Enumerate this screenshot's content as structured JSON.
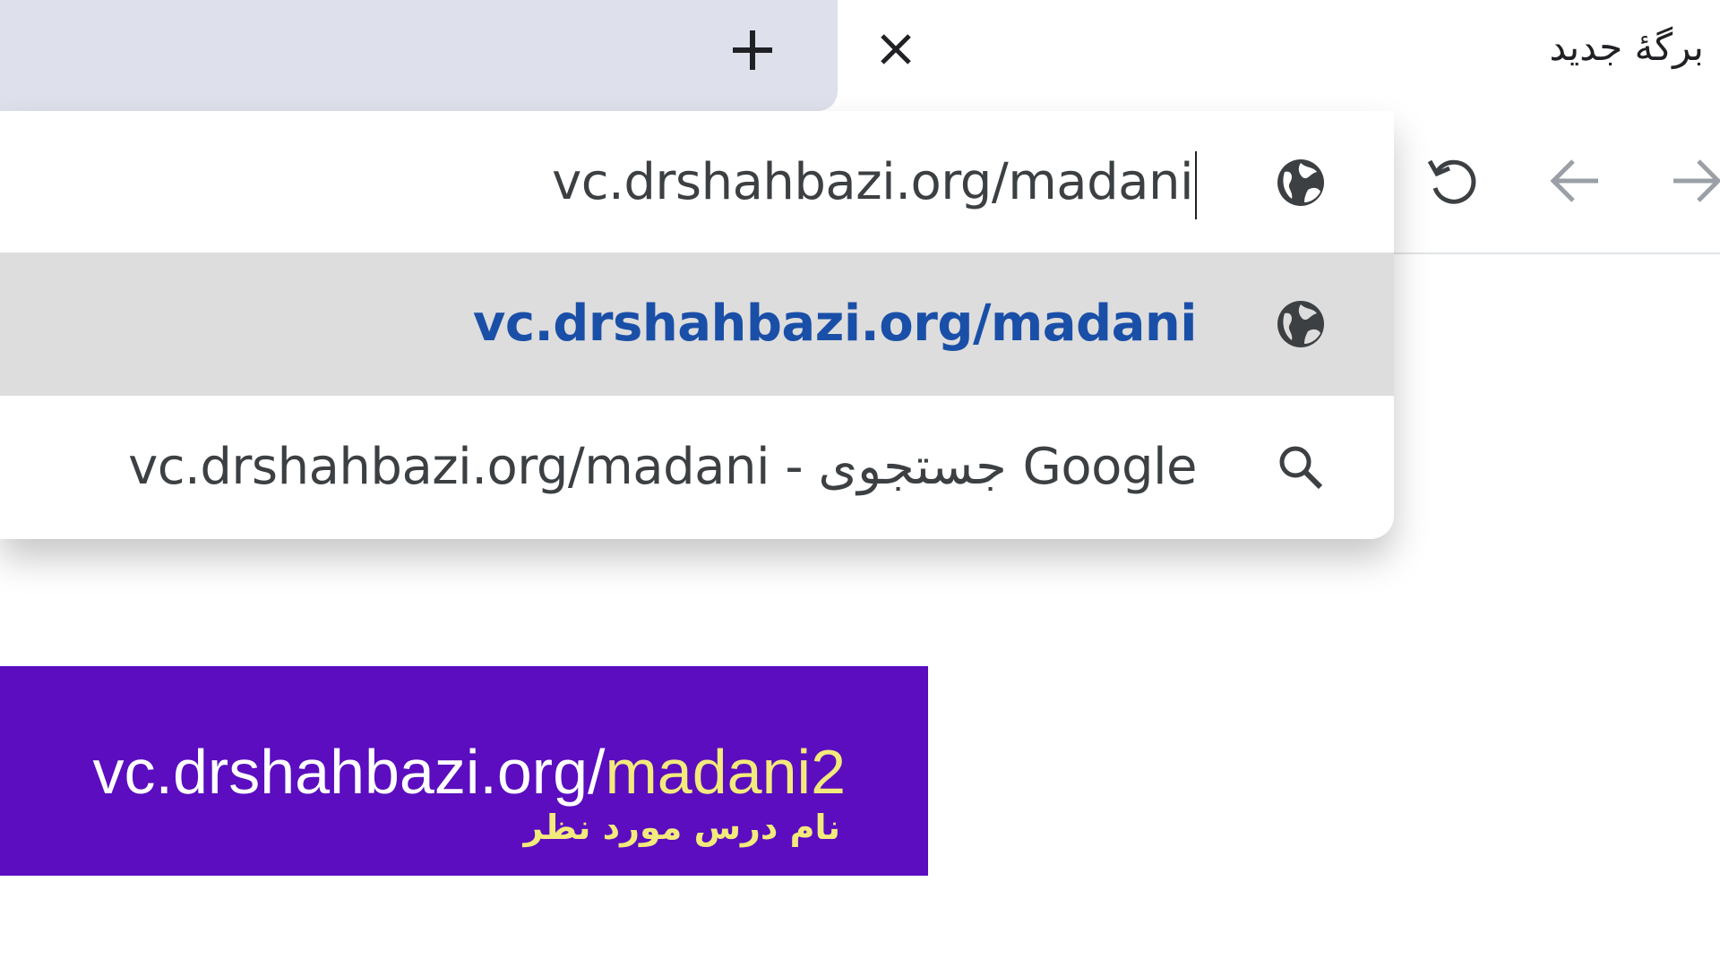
{
  "tabs": {
    "active_title": "برگهٔ جدید",
    "new_tab_icon": "plus-icon",
    "close_icon": "close-icon"
  },
  "toolbar": {
    "reload_icon": "reload-icon",
    "back_icon": "arrow-back-icon",
    "forward_icon": "arrow-forward-icon"
  },
  "omnibox": {
    "input_value": "vc.drshahbazi.org/madani",
    "input_icon": "globe-icon",
    "suggestions": [
      {
        "text": "vc.drshahbazi.org/madani",
        "icon": "globe-icon",
        "highlighted": true
      },
      {
        "text": "vc.drshahbazi.org/madani - جستجوی Google",
        "icon": "search-icon",
        "highlighted": false
      }
    ]
  },
  "banner": {
    "url_prefix": "vc.drshahbazi.org/",
    "url_suffix": "madani2",
    "caption": "نام درس مورد نظر"
  },
  "colors": {
    "banner_bg": "#5b0dbf",
    "banner_accent": "#f3ea7c",
    "suggest_link": "#1a4fa8",
    "tab_strip": "#dee1ec",
    "highlight_row": "#dddddd"
  }
}
